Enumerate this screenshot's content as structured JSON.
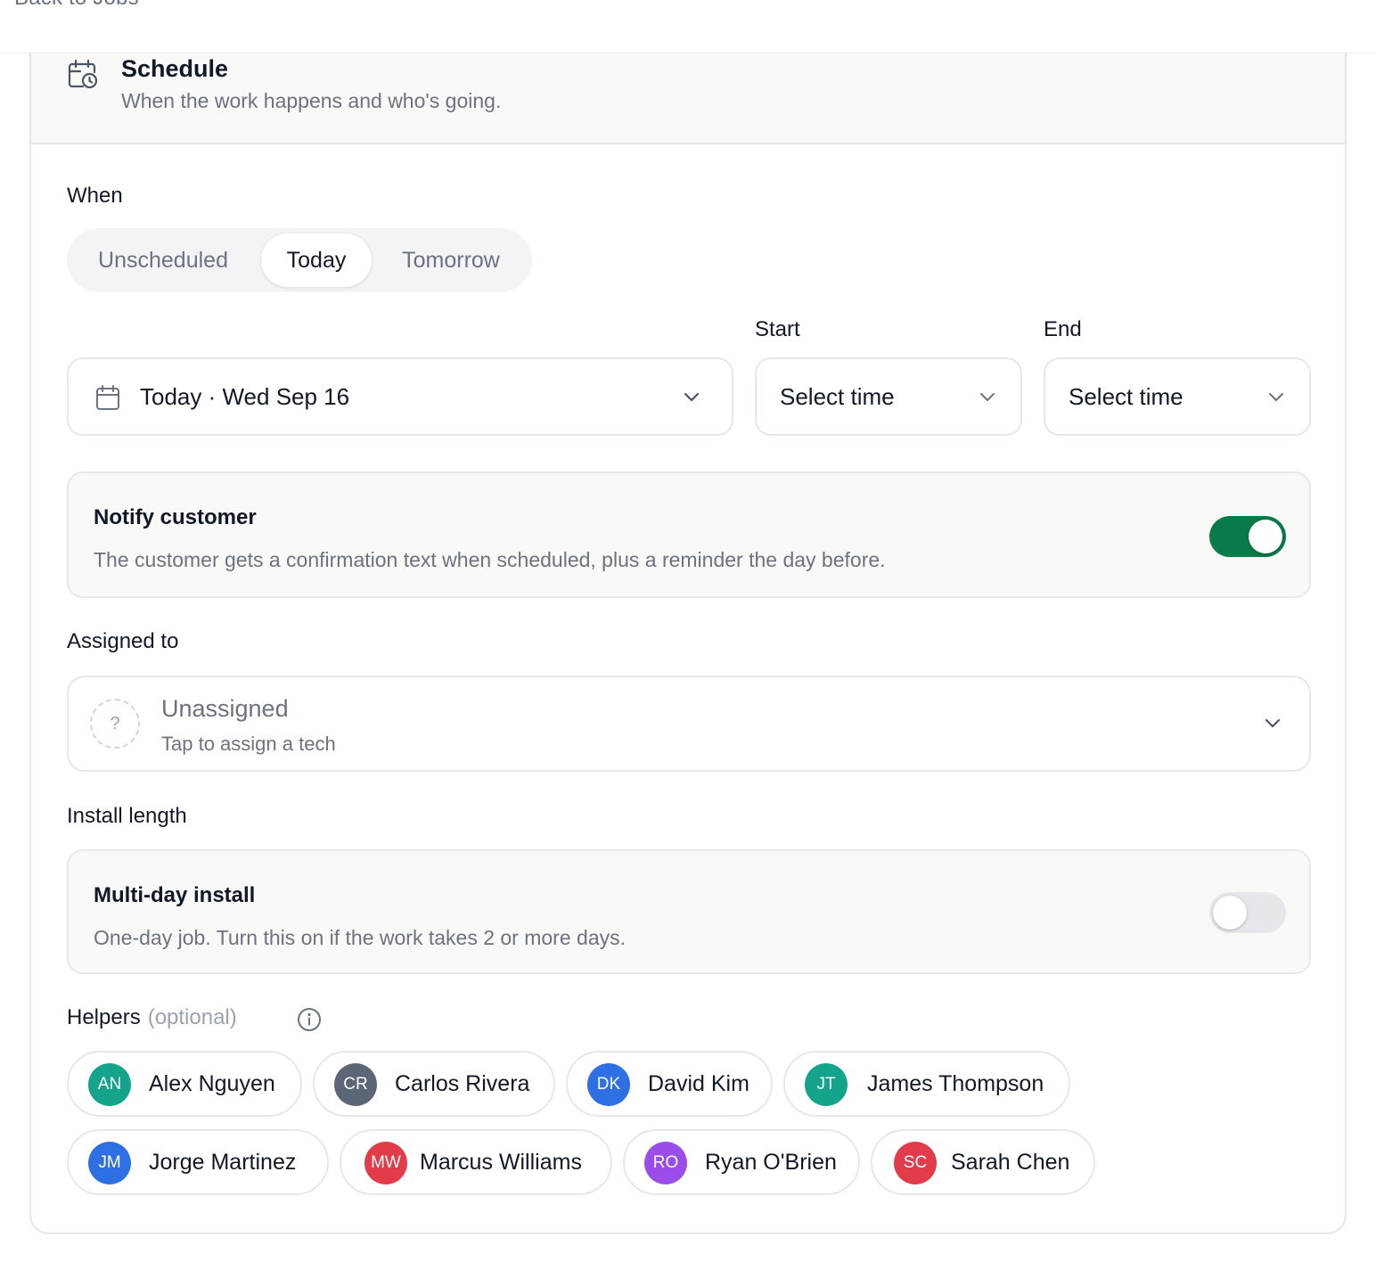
{
  "topbar": {
    "back_label": "Back to Jobs"
  },
  "section": {
    "icon": "calendar-clock-icon",
    "title": "Schedule",
    "subtitle": "When the work happens and who's going."
  },
  "when": {
    "label": "When",
    "options": [
      "Unscheduled",
      "Today",
      "Tomorrow"
    ],
    "selected": "Today"
  },
  "date_field": {
    "icon": "calendar-icon",
    "value": "Today · Wed Sep 16"
  },
  "start": {
    "label": "Start",
    "placeholder": "Select time"
  },
  "end": {
    "label": "End",
    "placeholder": "Select time"
  },
  "notify": {
    "title": "Notify customer",
    "description": "The customer gets a confirmation text when scheduled, plus a reminder the day before.",
    "enabled": true
  },
  "assigned": {
    "label": "Assigned to",
    "placeholder_icon": "?",
    "title": "Unassigned",
    "subtitle": "Tap to assign a tech"
  },
  "install_length": {
    "label": "Install length",
    "title": "Multi-day install",
    "description": "One-day job. Turn this on if the work takes 2 or more days.",
    "enabled": false
  },
  "helpers": {
    "label": "Helpers",
    "optional": "(optional)",
    "people": [
      {
        "initials": "AN",
        "name": "Alex Nguyen",
        "color": "#14a38b"
      },
      {
        "initials": "CR",
        "name": "Carlos Rivera",
        "color": "#5b6677"
      },
      {
        "initials": "DK",
        "name": "David Kim",
        "color": "#2f6fe4"
      },
      {
        "initials": "JT",
        "name": "James Thompson",
        "color": "#14a38b"
      },
      {
        "initials": "JM",
        "name": "Jorge Martinez",
        "color": "#2f6fe4"
      },
      {
        "initials": "MW",
        "name": "Marcus Williams",
        "color": "#e23b4a"
      },
      {
        "initials": "RO",
        "name": "Ryan O'Brien",
        "color": "#9a4de8"
      },
      {
        "initials": "SC",
        "name": "Sarah Chen",
        "color": "#e23b4a"
      }
    ]
  },
  "colors": {
    "toggle_on": "#0b7a4a",
    "toggle_off": "#e5e7eb",
    "muted_text": "#6b7280"
  }
}
